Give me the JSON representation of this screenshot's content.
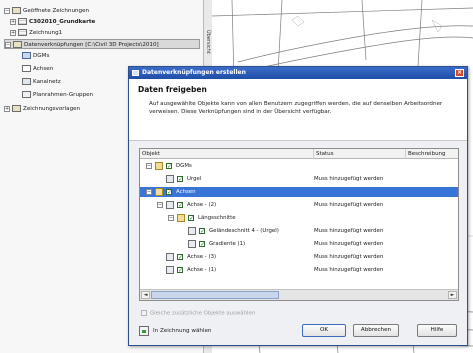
{
  "left_tree": {
    "items": [
      {
        "label": "Geöffnete Zeichnungen",
        "toggle": "−",
        "icon": "folder"
      },
      {
        "label": "C302010_Grundkarte",
        "toggle": "+",
        "icon": "drawing",
        "bold": true
      },
      {
        "label": "Zeichnung1",
        "toggle": "+",
        "icon": "drawing"
      },
      {
        "label": "Datenverknüpfungen [C:\\Civil 3D Projects\\2010]",
        "toggle": "−",
        "icon": "data-shortcuts",
        "selected": true
      },
      {
        "label": "DGMs",
        "icon": "surface"
      },
      {
        "label": "Achsen",
        "icon": "alignment"
      },
      {
        "label": "Kanalnetz",
        "icon": "pipe-network"
      },
      {
        "label": "Planrahmen-Gruppen",
        "icon": "view-frame"
      },
      {
        "label": "Zeichnungsvorlagen",
        "toggle": "+",
        "icon": "template"
      }
    ]
  },
  "side_tab_label": "Übersicht",
  "dialog": {
    "title": "Datenverknüpfungen erstellen",
    "header_title": "Daten freigeben",
    "header_desc": "Auf ausgewählte Objekte kann von allen Benutzern zugegriffen werden, die auf denselben Arbeitsordner verweisen. Diese Verknüpfungen sind in der Übersicht verfügbar.",
    "columns": [
      "Objekt",
      "Status",
      "Beschreibung"
    ],
    "rows": [
      {
        "label": "DGMs",
        "status": "",
        "indent": 0,
        "toggle": "−",
        "checked": true,
        "selected": false,
        "icon": "folder"
      },
      {
        "label": "Urgel",
        "status": "Muss hinzugefügt werden",
        "indent": 1,
        "toggle": "",
        "checked": true,
        "selected": false,
        "icon": "surface"
      },
      {
        "label": "Achsen",
        "status": "",
        "indent": 0,
        "toggle": "−",
        "checked": true,
        "selected": true,
        "icon": "folder"
      },
      {
        "label": "Achse - (2)",
        "status": "Muss hinzugefügt werden",
        "indent": 1,
        "toggle": "−",
        "checked": true,
        "selected": false,
        "icon": "alignment"
      },
      {
        "label": "Längsschnitte",
        "status": "",
        "indent": 2,
        "toggle": "−",
        "checked": true,
        "selected": false,
        "icon": "folder"
      },
      {
        "label": "Geländeschnitt 4 - (Urgel)",
        "status": "Muss hinzugefügt werden",
        "indent": 3,
        "toggle": "",
        "checked": true,
        "selected": false,
        "icon": "profile"
      },
      {
        "label": "Gradiente (1)",
        "status": "Muss hinzugefügt werden",
        "indent": 3,
        "toggle": "",
        "checked": true,
        "selected": false,
        "icon": "profile"
      },
      {
        "label": "Achse - (3)",
        "status": "Muss hinzugefügt werden",
        "indent": 1,
        "toggle": "",
        "checked": true,
        "selected": false,
        "icon": "alignment"
      },
      {
        "label": "Achse - (1)",
        "status": "Muss hinzugefügt werden",
        "indent": 1,
        "toggle": "",
        "checked": true,
        "selected": false,
        "icon": "alignment"
      }
    ],
    "share_option": "Gleiche zusätzliche Objekte auswählen",
    "pick_label": "In Zeichnung wählen",
    "ok_label": "OK",
    "cancel_label": "Abbrechen",
    "help_label": "Hilfe",
    "close_glyph": "×",
    "scroll_left": "◄",
    "scroll_right": "►"
  },
  "colors": {
    "titlebar": "#2456b3",
    "selection": "#3875d7",
    "check": "#2f7a2f",
    "close": "#d24a2c"
  }
}
